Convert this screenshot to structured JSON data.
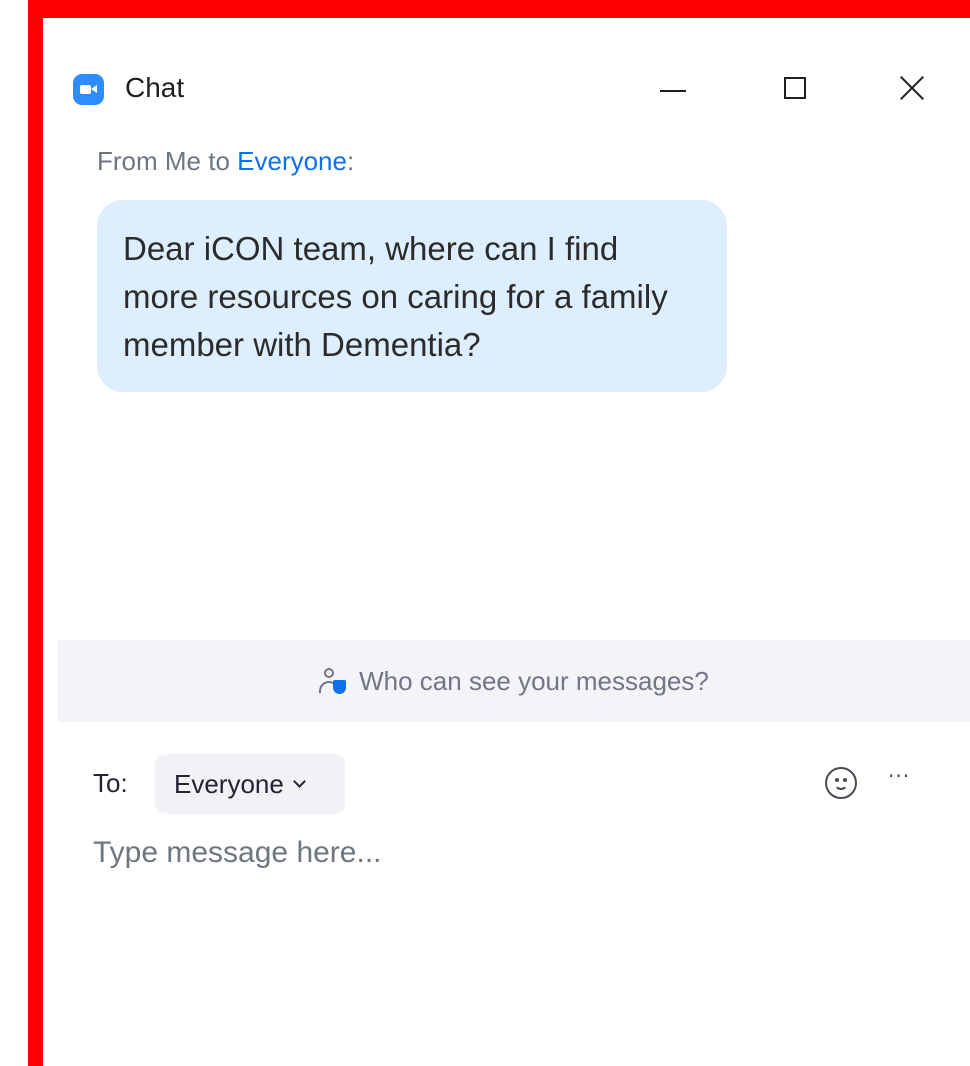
{
  "window": {
    "title": "Chat",
    "icon": "zoom-camera-icon",
    "controls": [
      "minimize-icon",
      "maximize-icon",
      "close-icon"
    ]
  },
  "message": {
    "from_prefix": "From Me to ",
    "recipient": "Everyone",
    "suffix": ":",
    "text": "Dear iCON team, where can I find more resources on caring for a family member with Dementia?"
  },
  "visibility": {
    "icon": "people-shield-icon",
    "text": "Who can see your messages?"
  },
  "composer": {
    "to_label": "To:",
    "to_value": "Everyone",
    "placeholder": "Type message here...",
    "value": "",
    "more_label": "···",
    "emoji_icon": "emoji-icon"
  },
  "colors": {
    "accent": "#0E71EB",
    "bubble": "#DDEEFF",
    "highlight_border": "#FF0000"
  }
}
